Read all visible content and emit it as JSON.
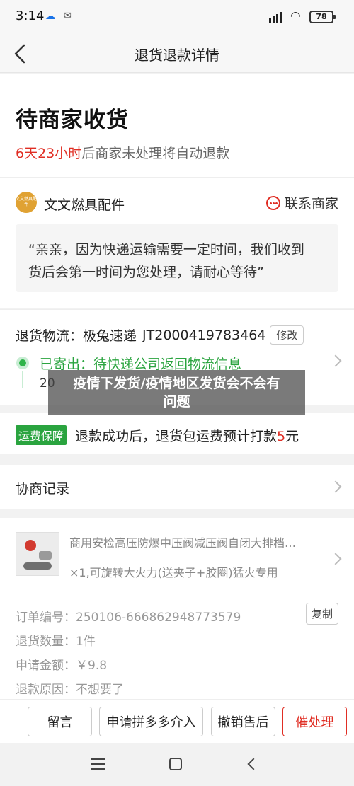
{
  "status_bar": {
    "time": "3:14",
    "battery": "78"
  },
  "nav": {
    "title": "退货退款详情"
  },
  "status": {
    "title": "待商家收货",
    "countdown": "6天23小时",
    "countdown_suffix": "后商家未处理将自动退款"
  },
  "shop": {
    "avatar_text": "文文燃具配件",
    "name": "文文燃具配件",
    "contact_label": "联系商家",
    "message_line1": "“亲亲，因为快递运输需要一定时间，我们收到",
    "message_line2": "货后会第一时间为您处理，请耐心等待”"
  },
  "logistics": {
    "label": "退货物流：",
    "carrier": "极兔速递",
    "tracking": "JT2000419783464",
    "edit_label": "修改",
    "status": "已寄出：待快递公司返回物流信息",
    "time_partial": "20"
  },
  "shipping": {
    "badge": "运费保障",
    "text": "退款成功后，退货包运费预计打款",
    "amount": "5",
    "unit": "元"
  },
  "negotiation": {
    "title": "协商记录"
  },
  "product": {
    "name": "商用安检高压防爆中压阀减压阀自闭大排档…",
    "spec": "×1,可旋转大火力(送夹子+胶圈)猛火专用"
  },
  "order": {
    "rows": [
      {
        "label": "订单编号：",
        "value": "250106-666862948773579"
      },
      {
        "label": "退货数量：",
        "value": "1件"
      },
      {
        "label": "申请金额：",
        "value": "￥9.8"
      },
      {
        "label": "退款原因：",
        "value": "不想要了"
      }
    ],
    "copy_label": "复制"
  },
  "actions": {
    "message": "留言",
    "intervene": "申请拼多多介入",
    "cancel": "撤销售后",
    "urge": "催处理"
  },
  "overlay": {
    "line1": "疫情下发货/疫情地区发货会不会有",
    "line2": "问题"
  }
}
